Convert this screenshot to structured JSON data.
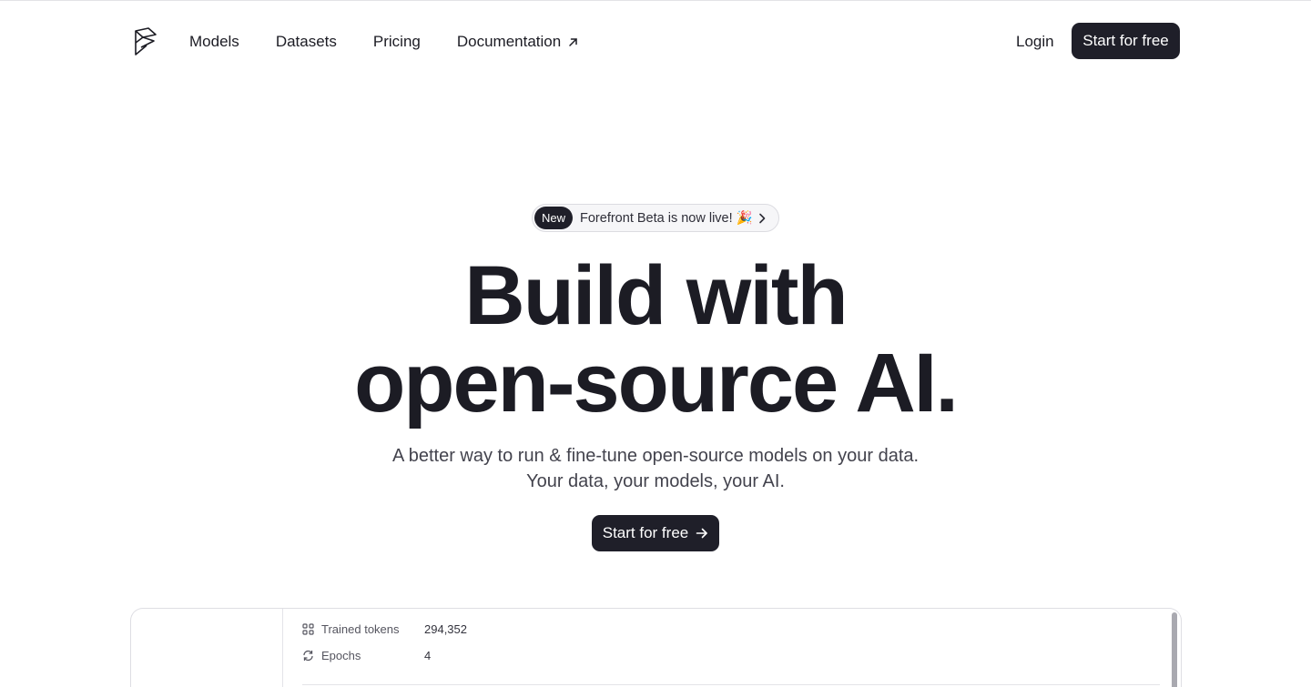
{
  "nav": {
    "links": [
      "Models",
      "Datasets",
      "Pricing",
      "Documentation"
    ],
    "login": "Login",
    "cta": "Start for free"
  },
  "badge": {
    "tag": "New",
    "text": "Forefront Beta is now live! 🎉"
  },
  "hero": {
    "title_line1": "Build with",
    "title_line2": "open-source AI.",
    "subtitle_line1": "A better way to run & fine-tune open-source models on your data.",
    "subtitle_line2": "Your data, your models, your AI.",
    "cta": "Start for free"
  },
  "preview": {
    "stats": [
      {
        "label": "Trained tokens",
        "value": "294,352",
        "icon": "grid-icon"
      },
      {
        "label": "Epochs",
        "value": "4",
        "icon": "refresh-icon"
      }
    ]
  },
  "colors": {
    "dark": "#1f1f29",
    "text": "#1c1c24",
    "muted": "#43434d"
  }
}
